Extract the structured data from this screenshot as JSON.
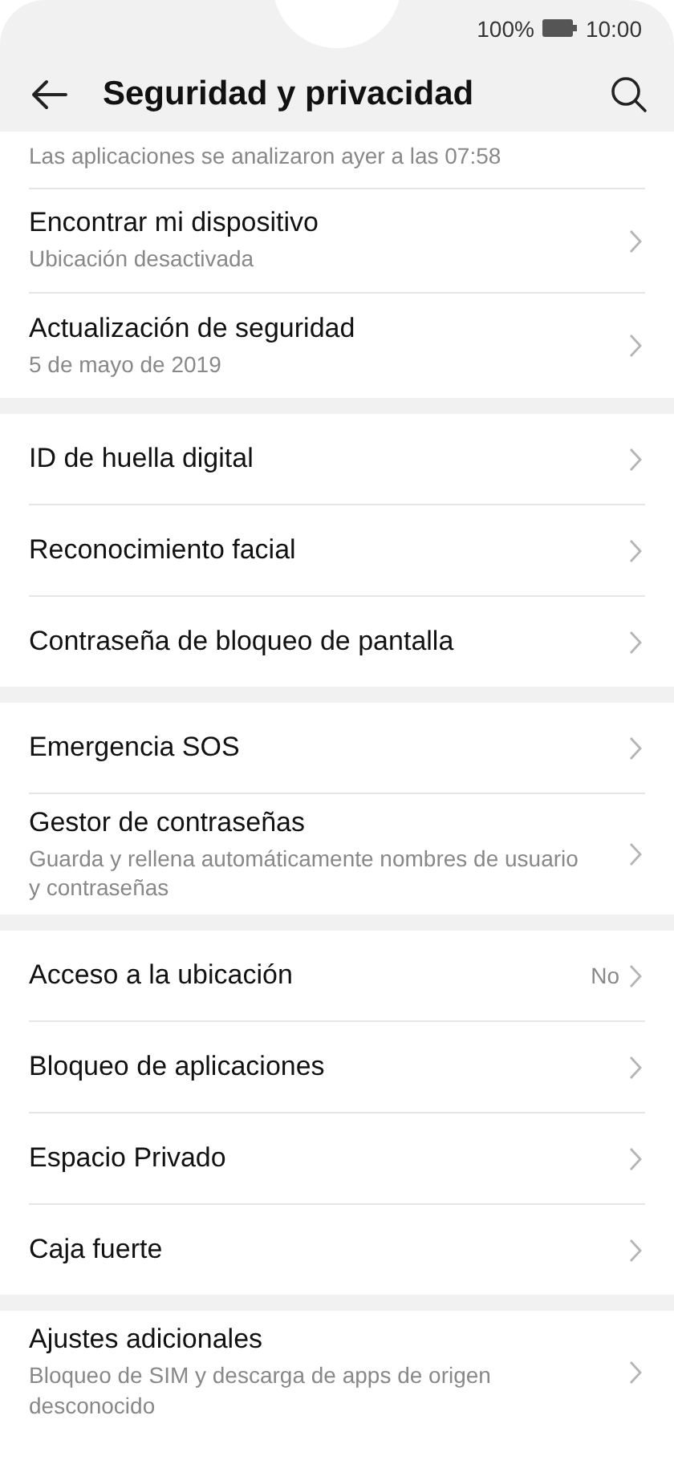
{
  "status_bar": {
    "battery": "100%",
    "time": "10:00"
  },
  "header": {
    "title": "Seguridad y privacidad"
  },
  "groups": [
    {
      "items": [
        {
          "kind": "partial",
          "subtitle": "Las aplicaciones se analizaron ayer a las 07:58"
        },
        {
          "kind": "row",
          "title": "Encontrar mi dispositivo",
          "subtitle": "Ubicación desactivada"
        },
        {
          "kind": "row",
          "title": "Actualización de seguridad",
          "subtitle": "5 de mayo de 2019"
        }
      ]
    },
    {
      "items": [
        {
          "kind": "row",
          "title": "ID de huella digital"
        },
        {
          "kind": "row",
          "title": "Reconocimiento facial"
        },
        {
          "kind": "row",
          "title": "Contraseña de bloqueo de pantalla"
        }
      ]
    },
    {
      "items": [
        {
          "kind": "row",
          "title": "Emergencia SOS"
        },
        {
          "kind": "row",
          "title": "Gestor de contraseñas",
          "subtitle": "Guarda y rellena automáticamente nombres de usuario y contraseñas"
        }
      ]
    },
    {
      "items": [
        {
          "kind": "row",
          "title": "Acceso a la ubicación",
          "value": "No"
        },
        {
          "kind": "row",
          "title": "Bloqueo de aplicaciones"
        },
        {
          "kind": "row",
          "title": "Espacio Privado"
        },
        {
          "kind": "row",
          "title": "Caja fuerte"
        }
      ]
    },
    {
      "items": [
        {
          "kind": "row",
          "title": "Ajustes adicionales",
          "subtitle": "Bloqueo de SIM y descarga de apps de origen desconocido"
        }
      ]
    }
  ]
}
